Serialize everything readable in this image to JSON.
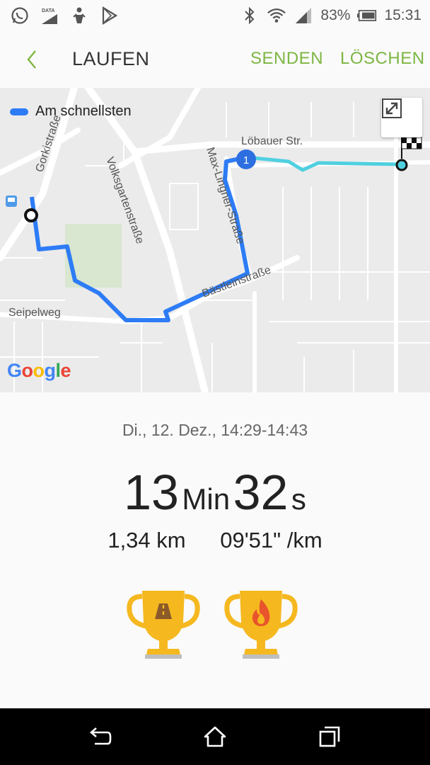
{
  "status_bar": {
    "battery_percent": "83%",
    "time": "15:31",
    "left_icons": [
      "whatsapp-icon",
      "data-icon",
      "notification-icon",
      "play-store-icon"
    ],
    "right_icons": [
      "bluetooth-icon",
      "wifi-icon",
      "signal-icon",
      "battery-icon"
    ],
    "data_label": "DATA"
  },
  "app_bar": {
    "title": "LAUFEN",
    "send_label": "SENDEN",
    "delete_label": "LÖSCHEN",
    "accent_color": "#7db644"
  },
  "map": {
    "legend_label": "Am schnellsten",
    "route_color": "#2d7cf6",
    "secondary_route_color": "#4fd0e0",
    "waypoint_label": "1",
    "streets": {
      "gorki": "Gorkistraße",
      "volksgarten": "Volksgartenstraße",
      "loebauer": "Löbauer Str.",
      "max_lingner": "Max-Lingner-Straße",
      "baestlein": "Bästleinstraße",
      "seipelweg": "Seipelweg"
    },
    "attribution": "Google"
  },
  "workout": {
    "date": "Di., 12. Dez., 14:29-14:43",
    "minutes": "13",
    "minutes_unit": "Min",
    "seconds": "32",
    "seconds_unit": "s",
    "distance": "1,34 km",
    "pace": "09'51\" /km",
    "trophies": [
      "road-trophy-icon",
      "flame-trophy-icon"
    ]
  }
}
